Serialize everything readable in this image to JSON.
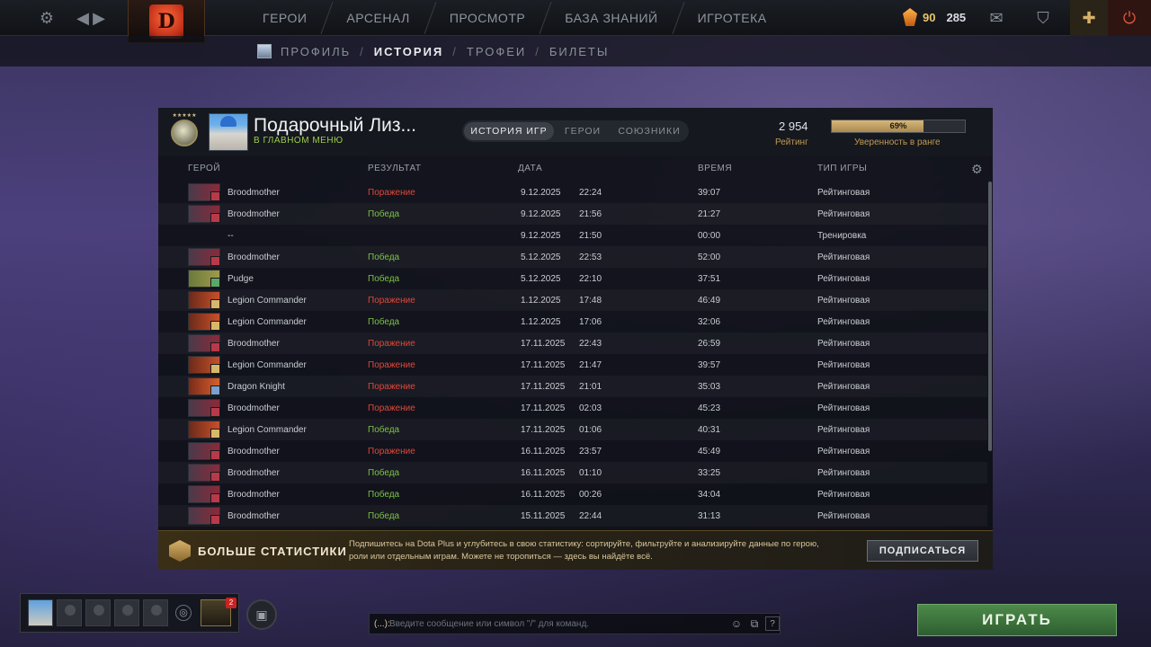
{
  "topbar": {
    "logo_glyph": "D",
    "nav": [
      "ГЕРОИ",
      "АРСЕНАЛ",
      "ПРОСМОТР",
      "БАЗА ЗНАНИЙ",
      "ИГРОТЕКА"
    ],
    "currency_gold": "90",
    "currency_white": "285",
    "icons": [
      "gear-icon",
      "back-arrow-icon",
      "forward-arrow-icon",
      "mail-icon",
      "armory-icon",
      "plus-icon",
      "power-icon"
    ]
  },
  "subnav": {
    "items": [
      "ПРОФИЛЬ",
      "ИСТОРИЯ",
      "ТРОФЕИ",
      "БИЛЕТЫ"
    ],
    "separator": "/"
  },
  "profile": {
    "name": "Подарочный Лиз...",
    "status": "В ГЛАВНОМ МЕНЮ",
    "medal_stars": "★★★★★",
    "rating_value": "2 954",
    "rating_label": "Рейтинг",
    "confidence_percent": 69,
    "confidence_text": "69%",
    "confidence_label": "Уверенность в ранге"
  },
  "tabs": [
    "ИСТОРИЯ ИГР",
    "ГЕРОИ",
    "СОЮЗНИКИ"
  ],
  "table": {
    "headers": [
      "ГЕРОЙ",
      "РЕЗУЛЬТАТ",
      "ДАТА",
      "ВРЕМЯ",
      "ТИП ИГРЫ"
    ],
    "rows": [
      {
        "hero": "Broodmother",
        "result": "Поражение",
        "res": "loss",
        "date": "9.12.2025",
        "time": "22:24",
        "duration": "39:07",
        "type": "Рейтинговая"
      },
      {
        "hero": "Broodmother",
        "result": "Победа",
        "res": "win",
        "date": "9.12.2025",
        "time": "21:56",
        "duration": "21:27",
        "type": "Рейтинговая"
      },
      {
        "hero": "--",
        "result": "",
        "res": "none",
        "date": "9.12.2025",
        "time": "21:50",
        "duration": "00:00",
        "type": "Тренировка"
      },
      {
        "hero": "Broodmother",
        "result": "Победа",
        "res": "win",
        "date": "5.12.2025",
        "time": "22:53",
        "duration": "52:00",
        "type": "Рейтинговая"
      },
      {
        "hero": "Pudge",
        "result": "Победа",
        "res": "win",
        "date": "5.12.2025",
        "time": "22:10",
        "duration": "37:51",
        "type": "Рейтинговая"
      },
      {
        "hero": "Legion Commander",
        "result": "Поражение",
        "res": "loss",
        "date": "1.12.2025",
        "time": "17:48",
        "duration": "46:49",
        "type": "Рейтинговая"
      },
      {
        "hero": "Legion Commander",
        "result": "Победа",
        "res": "win",
        "date": "1.12.2025",
        "time": "17:06",
        "duration": "32:06",
        "type": "Рейтинговая"
      },
      {
        "hero": "Broodmother",
        "result": "Поражение",
        "res": "loss",
        "date": "17.11.2025",
        "time": "22:43",
        "duration": "26:59",
        "type": "Рейтинговая"
      },
      {
        "hero": "Legion Commander",
        "result": "Поражение",
        "res": "loss",
        "date": "17.11.2025",
        "time": "21:47",
        "duration": "39:57",
        "type": "Рейтинговая"
      },
      {
        "hero": "Dragon Knight",
        "result": "Поражение",
        "res": "loss",
        "date": "17.11.2025",
        "time": "21:01",
        "duration": "35:03",
        "type": "Рейтинговая"
      },
      {
        "hero": "Broodmother",
        "result": "Поражение",
        "res": "loss",
        "date": "17.11.2025",
        "time": "02:03",
        "duration": "45:23",
        "type": "Рейтинговая"
      },
      {
        "hero": "Legion Commander",
        "result": "Победа",
        "res": "win",
        "date": "17.11.2025",
        "time": "01:06",
        "duration": "40:31",
        "type": "Рейтинговая"
      },
      {
        "hero": "Broodmother",
        "result": "Поражение",
        "res": "loss",
        "date": "16.11.2025",
        "time": "23:57",
        "duration": "45:49",
        "type": "Рейтинговая"
      },
      {
        "hero": "Broodmother",
        "result": "Победа",
        "res": "win",
        "date": "16.11.2025",
        "time": "01:10",
        "duration": "33:25",
        "type": "Рейтинговая"
      },
      {
        "hero": "Broodmother",
        "result": "Победа",
        "res": "win",
        "date": "16.11.2025",
        "time": "00:26",
        "duration": "34:04",
        "type": "Рейтинговая"
      },
      {
        "hero": "Broodmother",
        "result": "Победа",
        "res": "win",
        "date": "15.11.2025",
        "time": "22:44",
        "duration": "31:13",
        "type": "Рейтинговая"
      }
    ]
  },
  "promo": {
    "title": "БОЛЬШЕ СТАТИСТИКИ",
    "text": "Подпишитесь на Dota Plus и углубитесь в свою статистику: сортируйте, фильтруйте и анализируйте данные по герою, роли или отдельным играм. Можете не торопиться — здесь вы найдёте всё.",
    "button": "ПОДПИСАТЬСЯ"
  },
  "party": {
    "notification_count": "2"
  },
  "chat": {
    "prefix": "(...):",
    "placeholder": "Введите сообщение или символ \"/\" для команд.",
    "help": "?"
  },
  "play_button": "ИГРАТЬ",
  "colors": {
    "win": "#7bc345",
    "loss": "#e0483a",
    "accent_gold": "#c29a52",
    "play_green": "#4d8a4a"
  }
}
